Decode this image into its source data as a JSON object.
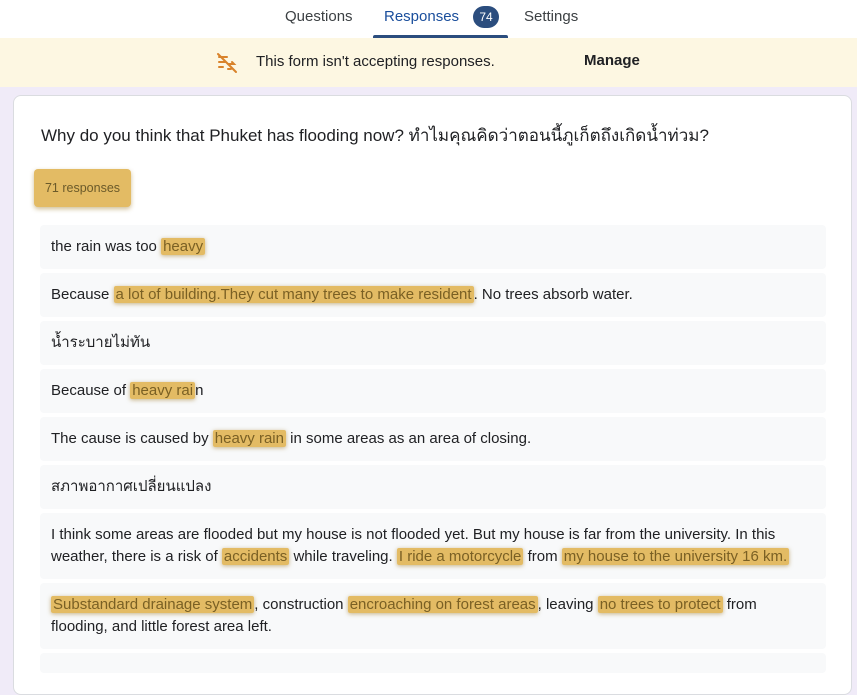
{
  "tabs": {
    "questions": "Questions",
    "responses": "Responses",
    "responses_count": "74",
    "settings": "Settings"
  },
  "banner": {
    "icon": "no-responses-icon",
    "message": "This form isn't accepting responses.",
    "manage": "Manage"
  },
  "question": {
    "title": "Why do you think that Phuket has flooding now? ทำไมคุณคิดว่าตอนนี้ภูเก็ตถึงเกิดน้ำท่วม?",
    "responses_label": "71 responses"
  },
  "responses": [
    {
      "parts": [
        {
          "t": "the rain was too "
        },
        {
          "t": "heavy",
          "hl": true
        }
      ]
    },
    {
      "parts": [
        {
          "t": "Because "
        },
        {
          "t": "a lot of building.They cut many trees to make resident",
          "hl": true
        },
        {
          "t": ". No trees absorb water."
        }
      ]
    },
    {
      "parts": [
        {
          "t": "น้ำระบายไม่ทัน"
        }
      ]
    },
    {
      "parts": [
        {
          "t": "Because of "
        },
        {
          "t": "heavy rai",
          "hl": true
        },
        {
          "t": "n"
        }
      ]
    },
    {
      "parts": [
        {
          "t": "The cause is caused by "
        },
        {
          "t": "heavy rain",
          "hl": true
        },
        {
          "t": " in some areas as an area of closing."
        }
      ]
    },
    {
      "parts": [
        {
          "t": "สภาพอากาศเปลี่ยนแปลง"
        }
      ]
    },
    {
      "parts": [
        {
          "t": "I think some areas are flooded but my house is not flooded yet. But my house is far from the university. In this weather, there is a risk of "
        },
        {
          "t": "accidents",
          "hl": true
        },
        {
          "t": " while traveling. "
        },
        {
          "t": "I ride a motorcycle",
          "hl": true
        },
        {
          "t": " from "
        },
        {
          "t": "my house to the university 16 km.",
          "hl": true
        }
      ]
    },
    {
      "parts": [
        {
          "t": "Substandard drainage system",
          "hl": true
        },
        {
          "t": ", construction "
        },
        {
          "t": "encroaching on forest areas",
          "hl": true
        },
        {
          "t": ", leaving "
        },
        {
          "t": "no trees to protect",
          "hl": true
        },
        {
          "t": " from flooding, and little forest area left."
        }
      ]
    }
  ],
  "colors": {
    "accent": "#2b4d7e",
    "highlight": "#e3bb64",
    "banner_bg": "#fdf7e2",
    "page_bg": "#f0ebf8"
  }
}
